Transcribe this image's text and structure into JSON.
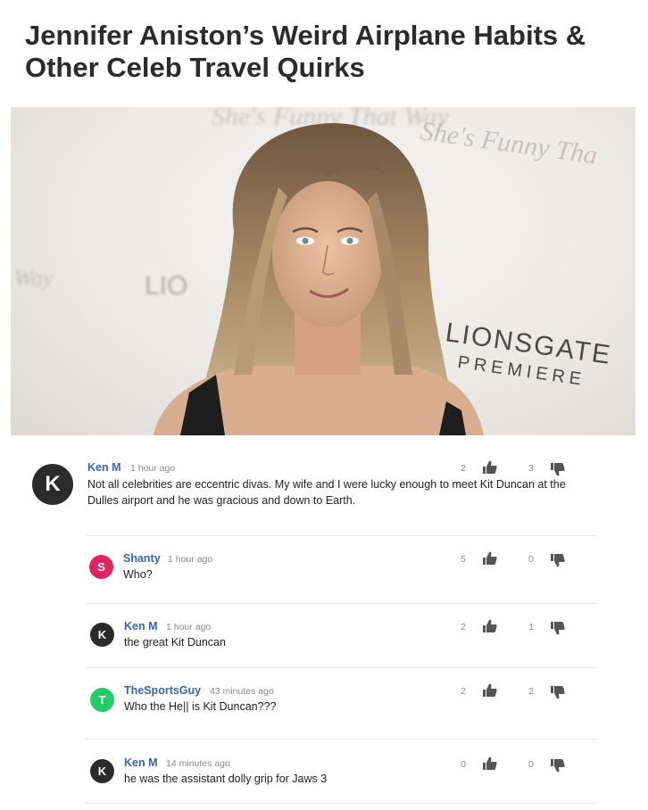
{
  "article": {
    "title": "Jennifer Aniston’s Weird Airplane Habits & Other Celeb Travel Quirks",
    "backdrop_text_1": "She's Funny That Way",
    "backdrop_text_2": "LIONSGATE",
    "backdrop_text_3": "PREMIERE"
  },
  "comments": [
    {
      "author": "Ken M",
      "initial": "K",
      "avatar_color": "#2b2b2b",
      "time": "1 hour ago",
      "text": "Not all celebrities are eccentric divas. My wife and I were lucky enough to meet Kit Duncan at the Dulles airport and he was gracious and down to Earth.",
      "upvotes": "2",
      "downvotes": "3"
    },
    {
      "author": "Shanty",
      "initial": "S",
      "avatar_color": "#e0245e",
      "time": "1 hour ago",
      "text": "Who?",
      "upvotes": "5",
      "downvotes": "0"
    },
    {
      "author": "Ken M",
      "initial": "K",
      "avatar_color": "#2b2b2b",
      "time": "1 hour ago",
      "text": "the great Kit Duncan",
      "upvotes": "2",
      "downvotes": "1"
    },
    {
      "author": "TheSportsGuy",
      "initial": "T",
      "avatar_color": "#22cc66",
      "time": "43 minutes ago",
      "text": "Who the He|| is Kit Duncan???",
      "upvotes": "2",
      "downvotes": "2"
    },
    {
      "author": "Ken M",
      "initial": "K",
      "avatar_color": "#2b2b2b",
      "time": "14 minutes ago",
      "text": "he was the assistant dolly grip for Jaws 3",
      "upvotes": "0",
      "downvotes": "0"
    }
  ],
  "icons": {
    "upvote": "thumbs-up-icon",
    "downvote": "thumbs-down-icon"
  },
  "colors": {
    "author_link": "#3a62b5",
    "divider": "#e6e6e6"
  }
}
